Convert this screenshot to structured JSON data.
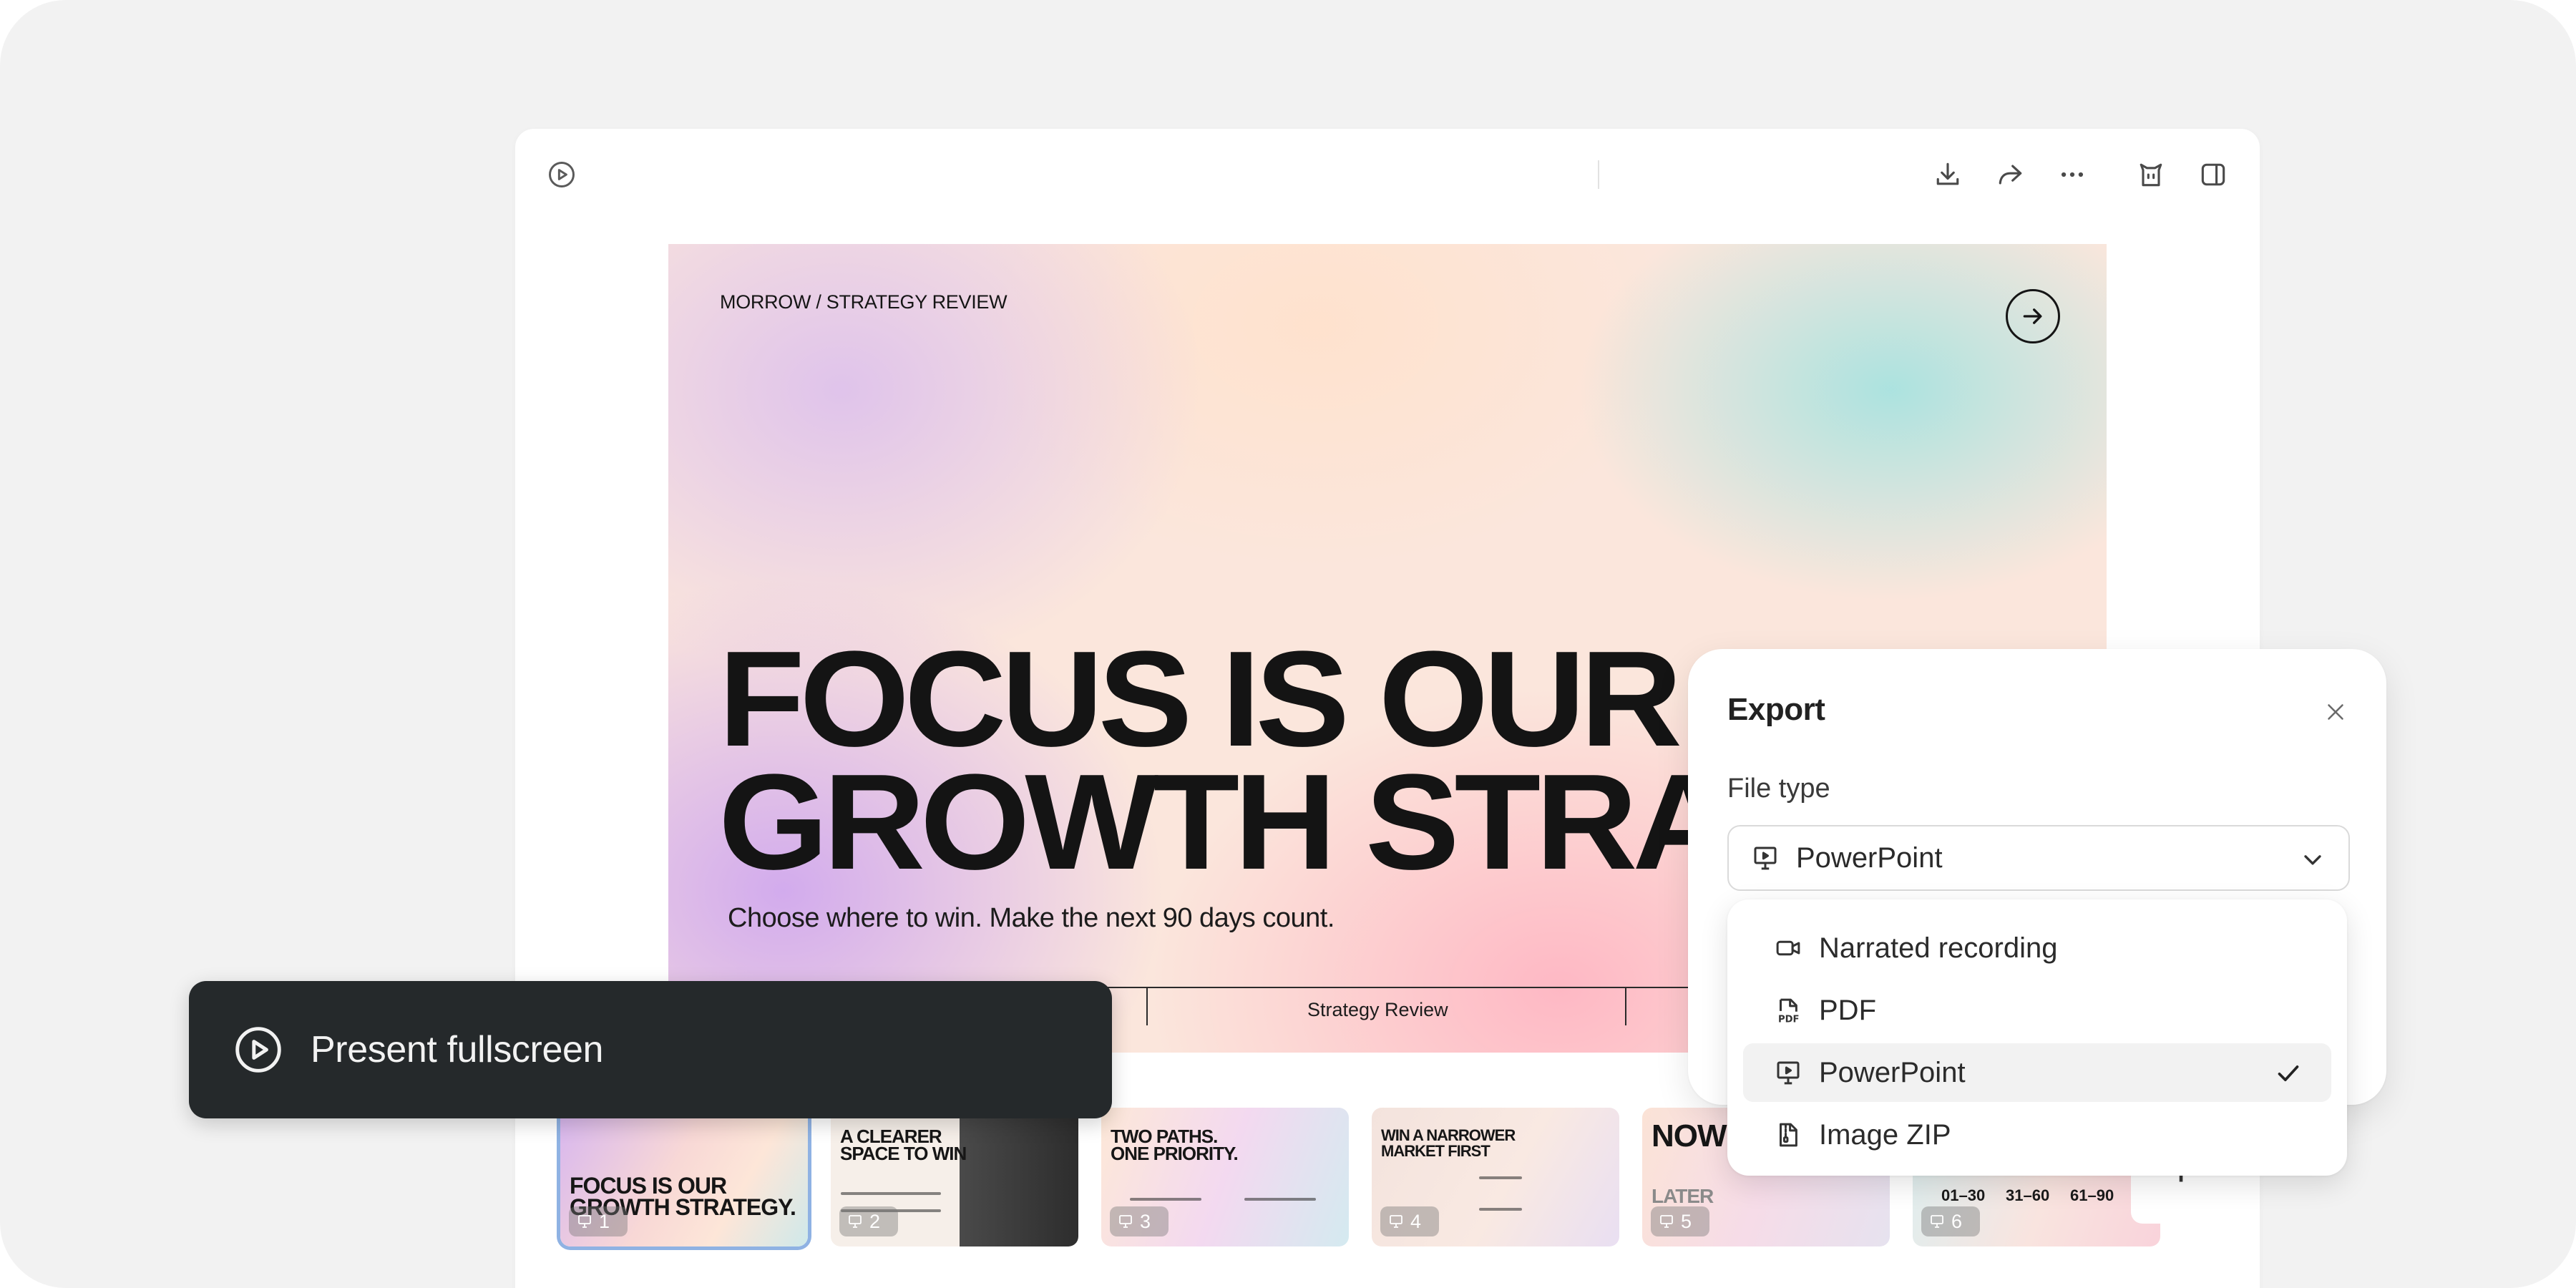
{
  "toolbar": {
    "icons": [
      "play-circle-icon",
      "download-icon",
      "share-icon",
      "more-icon",
      "assistant-icon",
      "sidebar-toggle-icon"
    ]
  },
  "slide": {
    "overline": "MORROW / STRATEGY REVIEW",
    "headline_line1": "FOCUS IS OUR",
    "headline_line2": "GROWTH STRA",
    "subline": "Choose where to win. Make the next 90 days count.",
    "footer_center": "Strategy Review"
  },
  "thumbnails": [
    {
      "title_line1": "FOCUS IS OUR",
      "title_line2": "GROWTH STRATEGY.",
      "number": "1"
    },
    {
      "title_line1": "A CLEARER",
      "title_line2": "SPACE TO WIN",
      "number": "2"
    },
    {
      "title_line1": "TWO PATHS.",
      "title_line2": "ONE PRIORITY.",
      "number": "3"
    },
    {
      "title_line1": "WIN A NARROWER",
      "title_line2": "MARKET FIRST",
      "number": "4"
    },
    {
      "title_line1": "NOW",
      "title_line2": "LATER",
      "number": "5"
    },
    {
      "title_line1": "01–30",
      "title_line2": "31–60",
      "title_line3": "61–90",
      "number": "6"
    }
  ],
  "present": {
    "label": "Present fullscreen"
  },
  "export": {
    "title": "Export",
    "file_type_label": "File type",
    "selected": "PowerPoint",
    "options": [
      {
        "label": "Narrated recording",
        "icon": "video-camera-icon",
        "selected": false
      },
      {
        "label": "PDF",
        "icon": "pdf-file-icon",
        "selected": false
      },
      {
        "label": "PowerPoint",
        "icon": "presentation-icon",
        "selected": true
      },
      {
        "label": "Image ZIP",
        "icon": "zip-file-icon",
        "selected": false
      }
    ]
  }
}
